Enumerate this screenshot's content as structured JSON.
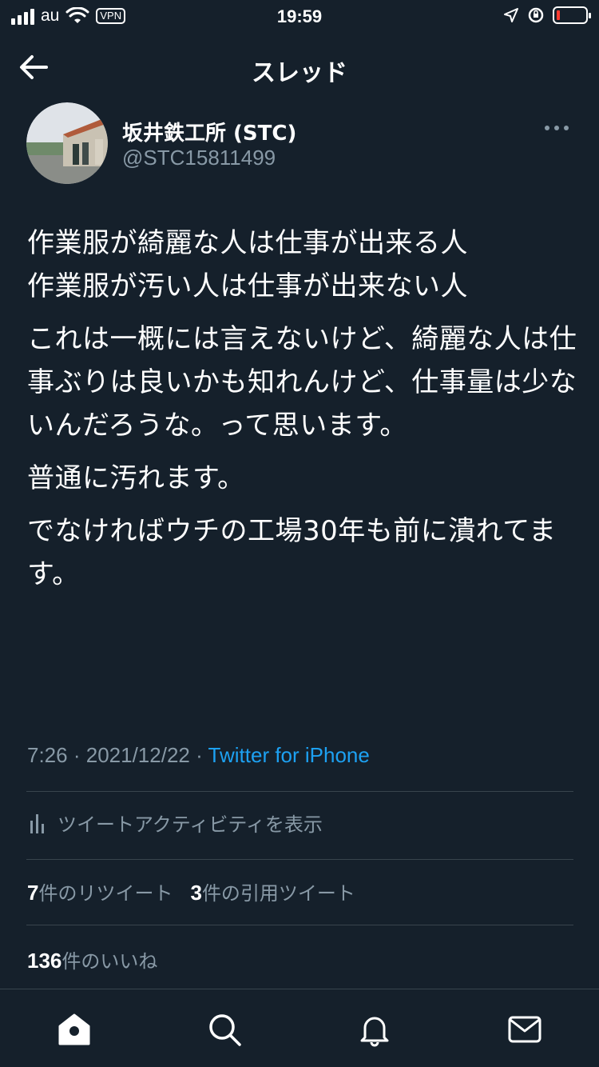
{
  "status_bar": {
    "carrier": "au",
    "vpn": "VPN",
    "time": "19:59"
  },
  "nav": {
    "title": "スレッド"
  },
  "tweet": {
    "author_name": "坂井鉄工所 (STC)",
    "author_handle": "@STC15811499",
    "paragraphs": [
      "作業服が綺麗な人は仕事が出来る人\n作業服が汚い人は仕事が出来ない人",
      "これは一概には言えないけど、綺麗な人は仕事ぶりは良いかも知れんけど、仕事量は少ないんだろうな。って思います。",
      "普通に汚れます。",
      "でなければウチの工場30年も前に潰れてます。"
    ],
    "time": "7:26",
    "date": "2021/12/22",
    "source": "Twitter for iPhone"
  },
  "activity": {
    "label": "ツイートアクティビティを表示"
  },
  "stats": {
    "retweets": "7",
    "retweets_label": "件のリツイート",
    "quotes": "3",
    "quotes_label": "件の引用ツイート",
    "likes": "136",
    "likes_label": "件のいいね"
  },
  "tabs": [
    "home-icon",
    "search-icon",
    "notifications-icon",
    "messages-icon"
  ],
  "colors": {
    "background": "#15202b",
    "accent": "#1da1f2",
    "secondary_text": "#8899a6",
    "divider": "#38444d"
  }
}
